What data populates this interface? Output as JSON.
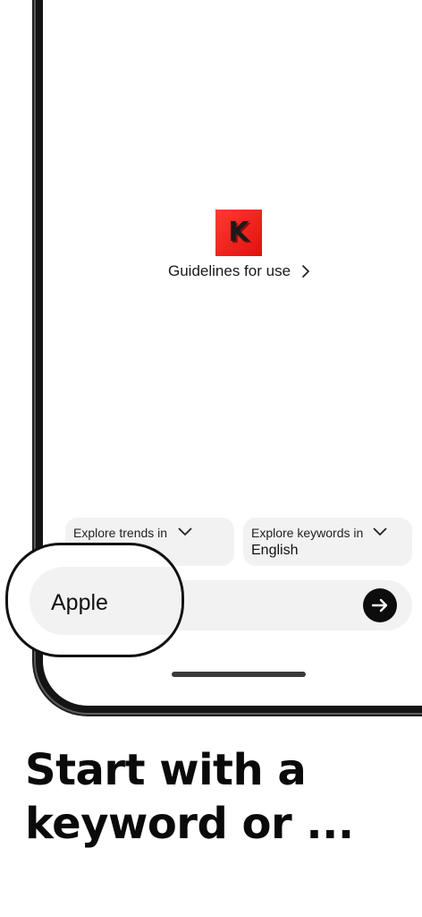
{
  "app": {
    "logo_letter": "K",
    "guidelines_label": "Guidelines for use"
  },
  "dropdowns": {
    "trends": {
      "label": "Explore trends in",
      "value": ""
    },
    "keywords": {
      "label": "Explore keywords in",
      "value": "English"
    }
  },
  "search": {
    "value": "Apple"
  },
  "headline": {
    "line1": "Start with a",
    "line2": "keyword or ..."
  },
  "colors": {
    "brand": "#e01010",
    "field_bg": "#f2f2f2",
    "frame": "#141414",
    "text": "#111111"
  },
  "icons": {
    "guidelines": "chevron-right-icon",
    "dropdown": "chevron-down-icon",
    "go": "arrow-right-icon"
  }
}
